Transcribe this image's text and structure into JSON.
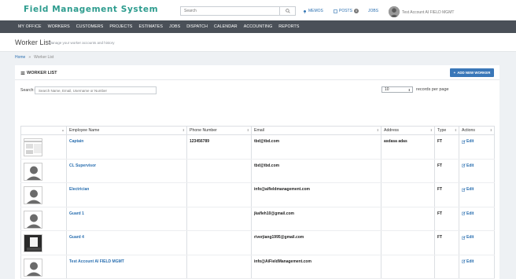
{
  "header": {
    "logo": "Field Management System",
    "search_placeholder": "Search",
    "memos_label": "MEMOS",
    "posts_label": "POSTS",
    "posts_badge": "0",
    "jobs_label": "JOBS",
    "user_name": "Test Account AI FIELD MGMT"
  },
  "nav": [
    "MY OFFICE",
    "WORKERS",
    "CUSTOMERS",
    "PROJECTS",
    "ESTIMATES",
    "JOBS",
    "DISPATCH",
    "CALENDAR",
    "ACCOUNTING",
    "REPORTS"
  ],
  "page": {
    "title": "Worker List",
    "subtitle": "Manage your worker accounts and history"
  },
  "breadcrumb": {
    "home": "Home",
    "current": "Worker List"
  },
  "panel": {
    "title": "WORKER LIST",
    "add_button": "ADD NEW WORKER",
    "search_label": "Search:",
    "search_placeholder": "Search Name, Email, Username or Number",
    "page_length": "10",
    "page_length_label": "records per page"
  },
  "table": {
    "headers": [
      "",
      "Employee Name",
      "Phone Number",
      "Email",
      "Address",
      "Type",
      "Actions"
    ],
    "edit_label": "Edit",
    "rows": [
      {
        "name": "Captain",
        "phone": "123456789",
        "email": "tbd@tbd.com",
        "address": "asdasa adas",
        "type": "FT",
        "photo": "screenshot"
      },
      {
        "name": "CL Supervisor",
        "phone": "",
        "email": "tbd@tbd.com",
        "address": "",
        "type": "FT",
        "photo": "silhouette"
      },
      {
        "name": "Electrician",
        "phone": "",
        "email": "info@aifieldmanagement.com",
        "address": "",
        "type": "FT",
        "photo": "silhouette"
      },
      {
        "name": "Guard 1",
        "phone": "",
        "email": "jkafleh10@gmail.com",
        "address": "",
        "type": "FT",
        "photo": "silhouette"
      },
      {
        "name": "Guard 4",
        "phone": "",
        "email": "riverjiang1995@gmail.com",
        "address": "",
        "type": "FT",
        "photo": "dark"
      },
      {
        "name": "Test Account AI FIELD MGMT",
        "phone": "",
        "email": "info@AiFieldManagement.com",
        "address": "",
        "type": "",
        "photo": "silhouette"
      }
    ]
  }
}
